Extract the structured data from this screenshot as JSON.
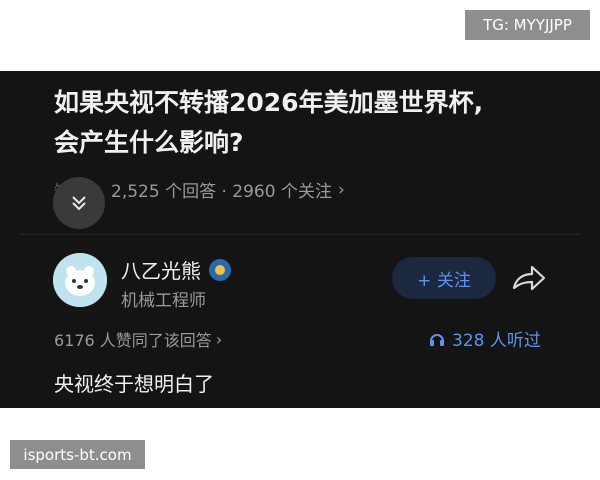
{
  "watermark_top": "TG: MYYJJPP",
  "watermark_bottom": "isports-bt.com",
  "question": {
    "title_line1": "如果央视不转播2026年美加墨世界杯,",
    "title_line2": "会产生什么影响?",
    "stats": "2,525 个回答 · 2960 个关注",
    "obscured_prefix": "知"
  },
  "author": {
    "name": "八乙光熊",
    "title": "机械工程师",
    "follow_label": "+ 关注"
  },
  "answer": {
    "agree_text": "6176 人赞同了该回答",
    "listen_text": "328 人听过",
    "text": "央视终于想明白了"
  },
  "icons": {
    "collapse": "chevron-double-down-icon",
    "share": "share-arrow-icon",
    "headphone": "headphone-icon"
  },
  "colors": {
    "background": "#141414",
    "accent": "#5f91ee",
    "follow_bg": "#1c2740"
  }
}
